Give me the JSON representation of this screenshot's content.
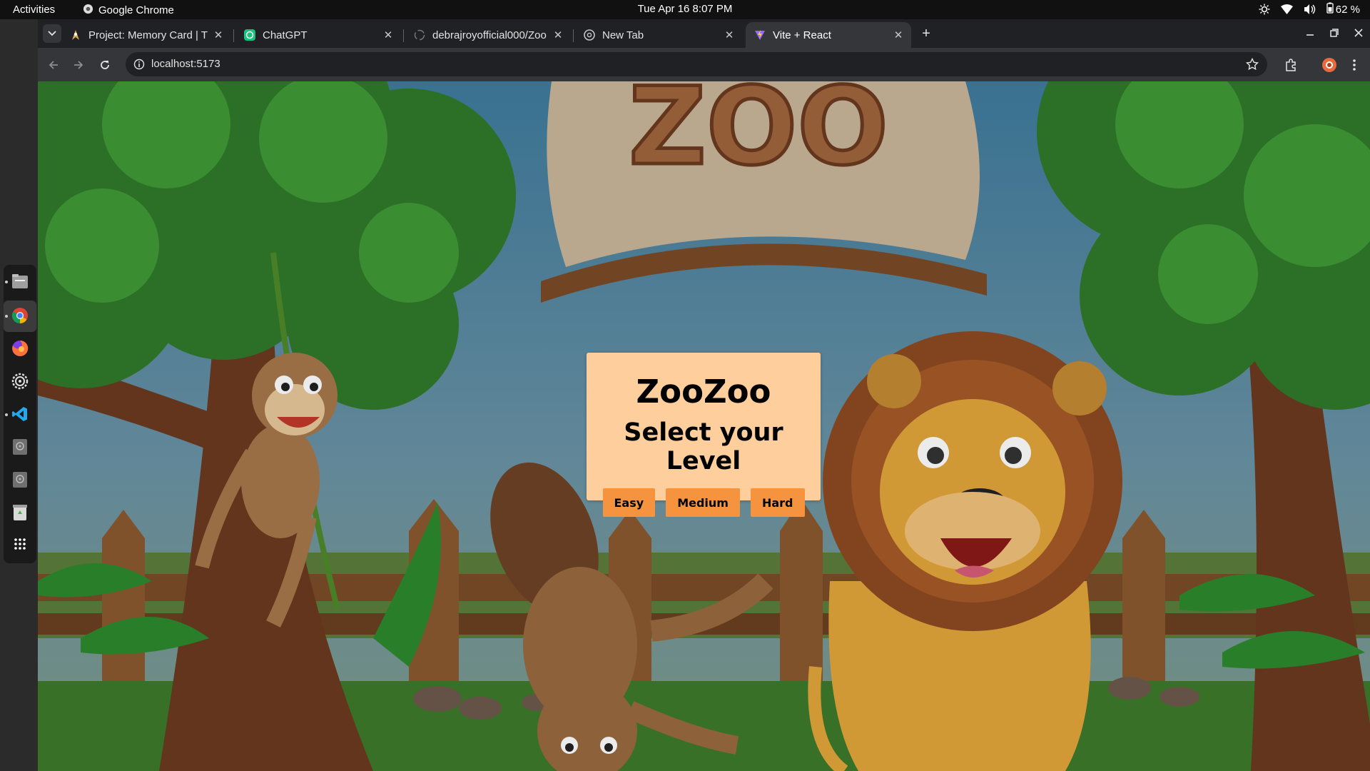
{
  "topbar": {
    "activities": "Activities",
    "app_name": "Google Chrome",
    "clock": "Tue Apr 16  8:07 PM",
    "battery": "62 %"
  },
  "dock": {
    "items": [
      "files-icon",
      "chrome-icon",
      "firefox-icon",
      "settings-icon",
      "vscode-icon",
      "disk-icon",
      "disk-icon",
      "trash-icon",
      "app-grid-icon"
    ]
  },
  "browser": {
    "tabs": [
      {
        "title": "Project: Memory Card | T",
        "icon": "odin-icon",
        "active": false
      },
      {
        "title": "ChatGPT",
        "icon": "chatgpt-icon",
        "active": false
      },
      {
        "title": "debrajroyofficial000/Zoo",
        "icon": "github-icon",
        "active": false
      },
      {
        "title": "New Tab",
        "icon": "chrome-icon",
        "active": false
      },
      {
        "title": "Vite + React",
        "icon": "vite-icon",
        "active": true
      }
    ],
    "url": "localhost:5173"
  },
  "page": {
    "game_title": "ZooZoo",
    "level_heading": "Select your Level",
    "levels": [
      "Easy",
      "Medium",
      "Hard"
    ],
    "sign_text": "ZOO"
  },
  "colors": {
    "modal_bg": "#fecf9d",
    "button_bg": "#f6933e",
    "topbar_bg": "#111111",
    "chrome_bg": "#202124"
  }
}
